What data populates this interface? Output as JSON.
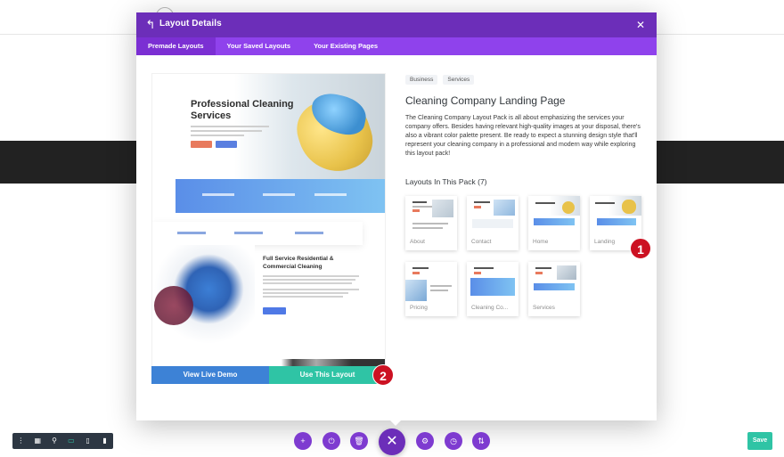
{
  "modal": {
    "title": "Layout Details",
    "tabs": [
      {
        "label": "Premade Layouts",
        "active": true
      },
      {
        "label": "Your Saved Layouts",
        "active": false
      },
      {
        "label": "Your Existing Pages",
        "active": false
      }
    ]
  },
  "preview": {
    "hero_title": "Professional Cleaning Services",
    "section_title": "Full Service Residential & Commercial Cleaning",
    "view_live_demo": "View Live Demo",
    "use_this_layout": "Use This Layout"
  },
  "detail": {
    "tags": [
      "Business",
      "Services"
    ],
    "title": "Cleaning Company Landing Page",
    "description": "The Cleaning Company Layout Pack is all about emphasizing the services your company offers. Besides having relevant high-quality images at your disposal, there's also a vibrant color palette present. Be ready to expect a stunning design style that'll represent your cleaning company in a professional and modern way while exploring this layout pack!",
    "pack_title": "Layouts In This Pack (7)",
    "layouts": [
      "About",
      "Contact",
      "Home",
      "Landing",
      "Pricing",
      "Cleaning Co...",
      "Services"
    ]
  },
  "markers": [
    "1",
    "2"
  ],
  "toolbar": {
    "left_icons": [
      "dots-icon",
      "wireframe-icon",
      "zoom-icon",
      "desktop-icon",
      "tablet-icon",
      "phone-icon"
    ],
    "save_label": "Save"
  },
  "colors": {
    "header": "#6c2eb9",
    "tabs": "#8f42ec",
    "live_demo": "#3d82d6",
    "use_layout": "#2fc4a5",
    "marker": "#cc1122",
    "save": "#2fc4a5"
  }
}
